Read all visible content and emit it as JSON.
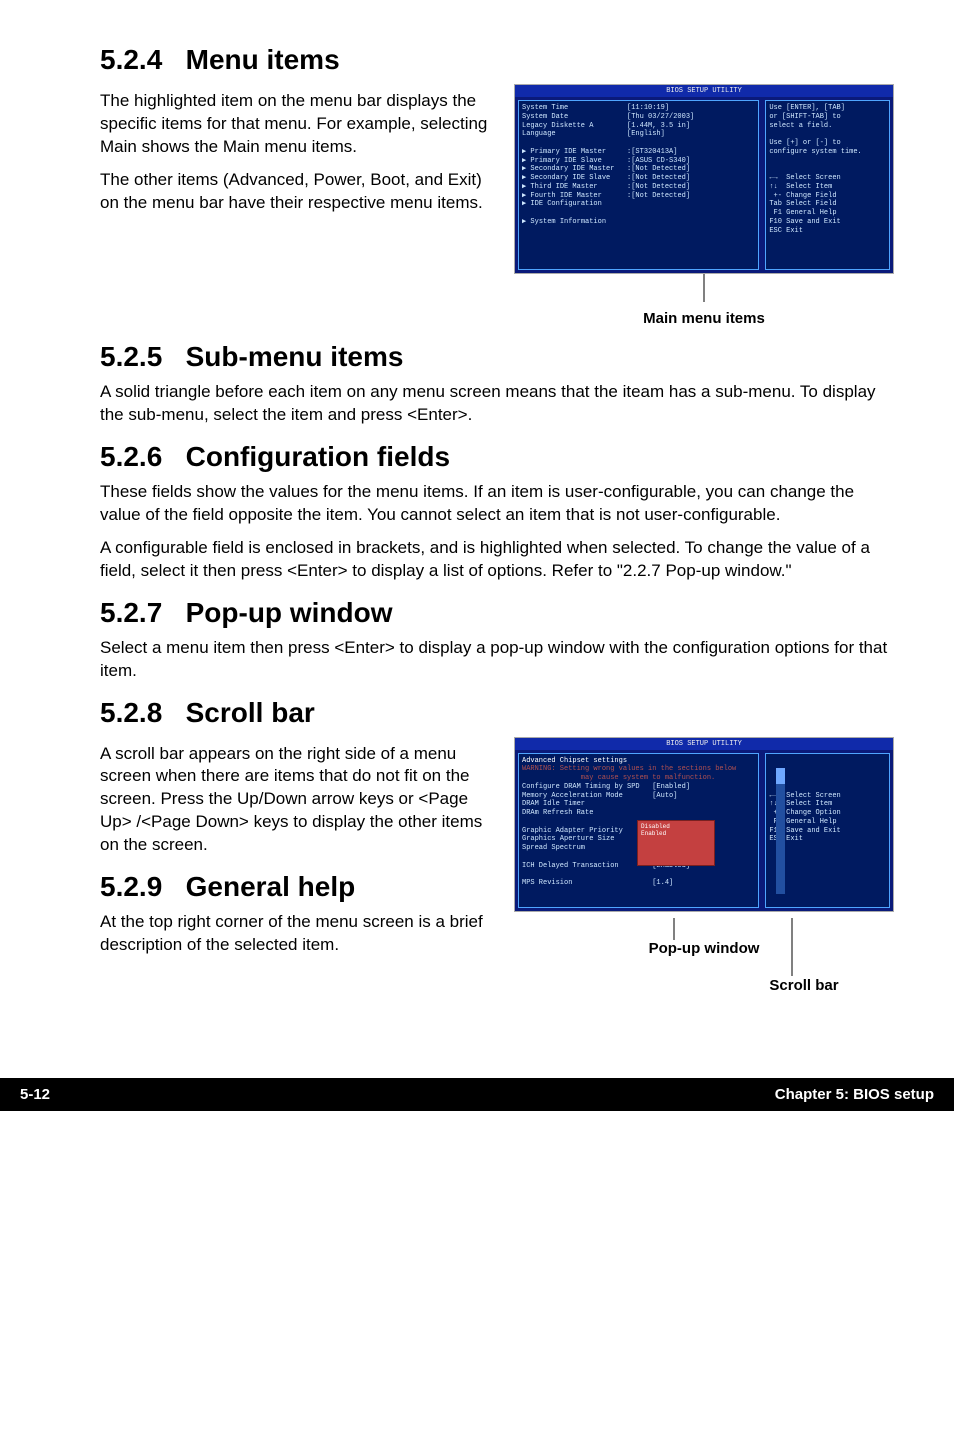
{
  "sections": {
    "s524": {
      "num": "5.2.4",
      "title": "Menu items"
    },
    "s525": {
      "num": "5.2.5",
      "title": "Sub-menu items"
    },
    "s526": {
      "num": "5.2.6",
      "title": "Configuration fields"
    },
    "s527": {
      "num": "5.2.7",
      "title": "Pop-up window"
    },
    "s528": {
      "num": "5.2.8",
      "title": "Scroll bar"
    },
    "s529": {
      "num": "5.2.9",
      "title": "General help"
    }
  },
  "paras": {
    "p1": "The highlighted item on the menu bar displays the specific items for that menu. For example, selecting Main shows the Main menu items.",
    "p2": "The other items (Advanced, Power, Boot, and Exit) on the menu bar have their respective menu items.",
    "p3": "A solid triangle before each item on any menu screen means that the iteam has a sub-menu. To display the sub-menu, select the item and press <Enter>.",
    "p4": "These fields show the values for the menu items. If an item is user-configurable, you can change the value of the field opposite the item. You cannot select an item that is not user-configurable.",
    "p5": "A configurable field is enclosed in brackets, and is highlighted when selected. To change the value of a field, select it then press <Enter> to display a list of options. Refer to \"2.2.7 Pop-up window.\"",
    "p6": "Select a menu item then press <Enter> to display a pop-up window with the configuration options for that item.",
    "p7": "A scroll bar appears on the right side of a menu screen when there are items that do not fit on the screen. Press the Up/Down arrow keys or <Page Up> /<Page Down> keys to display the other items on the screen.",
    "p8": "At the top right corner of the menu screen is a brief description of the selected item."
  },
  "captions": {
    "main_menu": "Main menu items",
    "popup": "Pop-up window",
    "scrollbar": "Scroll bar"
  },
  "bios1": {
    "title": "BIOS SETUP UTILITY",
    "left_lines": [
      "System Time              [11:10:19]",
      "System Date              [Thu 03/27/2003]",
      "Legacy Diskette A        [1.44M, 3.5 in]",
      "Language                 [English]",
      "",
      "▶ Primary IDE Master     :[ST320413A]",
      "▶ Primary IDE Slave      :[ASUS CD-S340]",
      "▶ Secondary IDE Master   :[Not Detected]",
      "▶ Secondary IDE Slave    :[Not Detected]",
      "▶ Third IDE Master       :[Not Detected]",
      "▶ Fourth IDE Master      :[Not Detected]",
      "▶ IDE Configuration",
      "",
      "▶ System Information"
    ],
    "right_lines": [
      "Use [ENTER], [TAB]",
      "or [SHIFT-TAB] to",
      "select a field.",
      "",
      "Use [+] or [-] to",
      "configure system time.",
      "",
      "",
      "←→  Select Screen",
      "↑↓  Select Item",
      " +- Change Field",
      "Tab Select Field",
      " F1 General Help",
      "F10 Save and Exit",
      "ESC Exit"
    ]
  },
  "bios2": {
    "title": "BIOS SETUP UTILITY",
    "heading": "Advanced Chipset settings",
    "warning": "WARNING: Setting wrong values in the sections below\n         may cause system to malfunction.",
    "left_lines": [
      "Configure DRAM Timing by SPD   [Enabled]",
      "Memory Acceleration Mode       [Auto]",
      "DRAM Idle Timer",
      "DRAm Refresh Rate",
      "",
      "Graphic Adapter Priority",
      "Graphics Aperture Size",
      "Spread Spectrum                [Enabled]",
      "",
      "ICH Delayed Transaction        [Enabled]",
      "",
      "MPS Revision                   [1.4]"
    ],
    "right_lines": [
      "",
      "",
      "",
      "",
      "←→  Select Screen",
      "↑↓  Select Item",
      " +- Change Option",
      " F1 General Help",
      "F10 Save and Exit",
      "ESC Exit"
    ],
    "popup_lines": [
      "Disabled",
      "Enabled"
    ]
  },
  "footer": {
    "left": "5-12",
    "right": "Chapter 5: BIOS setup"
  }
}
